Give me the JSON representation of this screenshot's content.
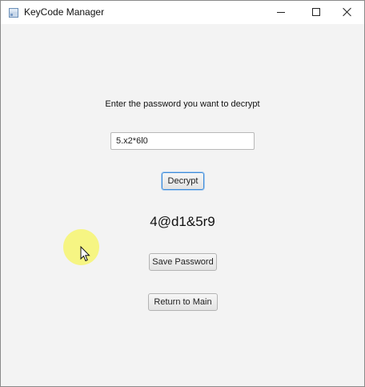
{
  "window": {
    "title": "KeyCode Manager",
    "icon": "app-window-icon",
    "controls": {
      "minimize_icon": "minimize-icon",
      "maximize_icon": "maximize-icon",
      "close_icon": "close-icon"
    }
  },
  "form": {
    "prompt": "Enter the password you want to decrypt",
    "password_value": "5.x2*6l0",
    "decrypt_label": "Decrypt",
    "decrypted_result": "4@d1&5r9",
    "save_label": "Save Password",
    "return_label": "Return to Main"
  },
  "pointer": {
    "icon": "mouse-cursor-icon",
    "highlight_color": "#f6f46e"
  },
  "colors": {
    "background": "#f3f3f3",
    "focus_border": "#3c8ad8"
  }
}
